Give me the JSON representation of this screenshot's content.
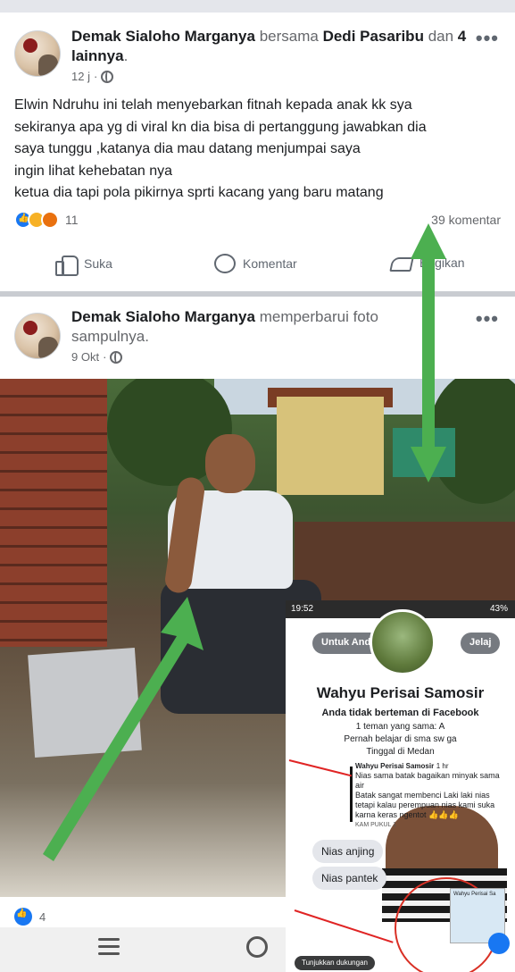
{
  "post1": {
    "author": "Demak Sialoho Marganya",
    "with_word": "bersama",
    "tagged": "Dedi Pasaribu",
    "and_word": "dan",
    "others": "4 lainnya",
    "period": ".",
    "time": "12 j",
    "dot": "·",
    "more_icon": "•••",
    "text_lines": [
      "Elwin Ndruhu ini telah menyebarkan fitnah kepada anak kk sya",
      "sekiranya apa yg di viral kn dia bisa di pertanggung jawabkan dia",
      "saya tunggu ,katanya dia mau datang menjumpai saya",
      "ingin lihat kehebatan nya",
      "ketua dia tapi pola pikirnya sprti kacang yang baru matang"
    ],
    "reaction_count": "11",
    "comment_count": "39 komentar",
    "actions": {
      "like": "Suka",
      "comment": "Komentar",
      "share": "Bagikan"
    }
  },
  "post2": {
    "author": "Demak Sialoho Marganya",
    "action_text": "memperbarui foto sampulnya.",
    "time": "9 Okt",
    "dot": "·",
    "more_icon": "•••",
    "reaction_count": "4"
  },
  "inset": {
    "status_time": "19:52",
    "battery": "43%",
    "pill_left": "Untuk Anda",
    "pill_right": "Jelaj",
    "name": "Wahyu Perisai Samosir",
    "not_friend": "Anda tidak berteman di Facebook",
    "mutual": "1 teman yang sama: A",
    "studied": "Pernah belajar di sma sw",
    "studied_tail": "ga",
    "lives": "Tinggal di Medan",
    "comment_name": "Wahyu Perisai Samosir",
    "comment_time": "1 hr",
    "comment_text_1": "Nias sama batak bagaikan minyak sama air",
    "comment_text_2": "Batak sangat membenci Laki laki nias tetapi kalau perempuan nias kami suka karna keras ngentot 👍👍👍",
    "caption_bit": "KAM PUKUL 1",
    "chat_1": "Nias anjing",
    "chat_2": "Nias pantek",
    "card_title": "Wahyu Perisai Sa",
    "support": "Tunjukkan dukungan"
  },
  "colors": {
    "accent_blue": "#1877f2",
    "arrow_green": "#4caf50",
    "muted": "#65676b",
    "mark_red": "#e02424"
  }
}
